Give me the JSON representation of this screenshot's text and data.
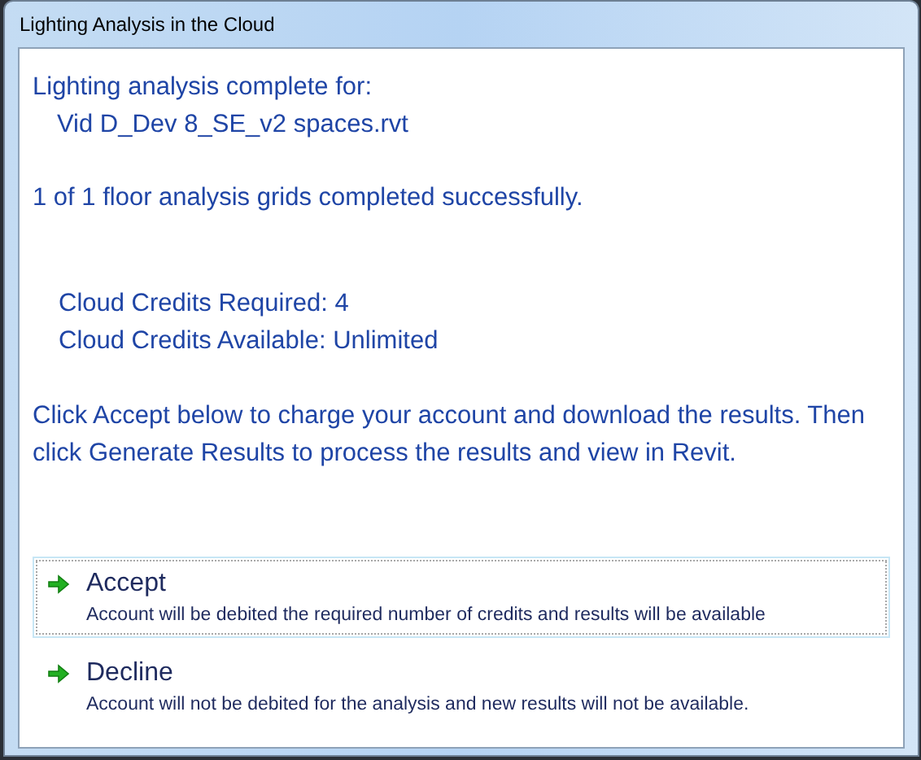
{
  "window": {
    "title": "Lighting Analysis in the Cloud"
  },
  "header": "Lighting analysis complete for:",
  "file_name": "Vid D_Dev 8_SE_v2 spaces.rvt",
  "summary": "1 of 1 floor analysis grids completed successfully.",
  "credits": [
    "Cloud Credits Required: 4",
    "Cloud Credits Available: Unlimited"
  ],
  "instructions": "Click Accept below to charge your account and download the results. Then click Generate Results to process the results and view in Revit.",
  "options": [
    {
      "label": "Accept",
      "description": "Account will be debited the required number of credits and results will be available",
      "focused": true
    },
    {
      "label": "Decline",
      "description": "Account will not be debited for the analysis and new results will not be available.",
      "focused": false
    }
  ]
}
